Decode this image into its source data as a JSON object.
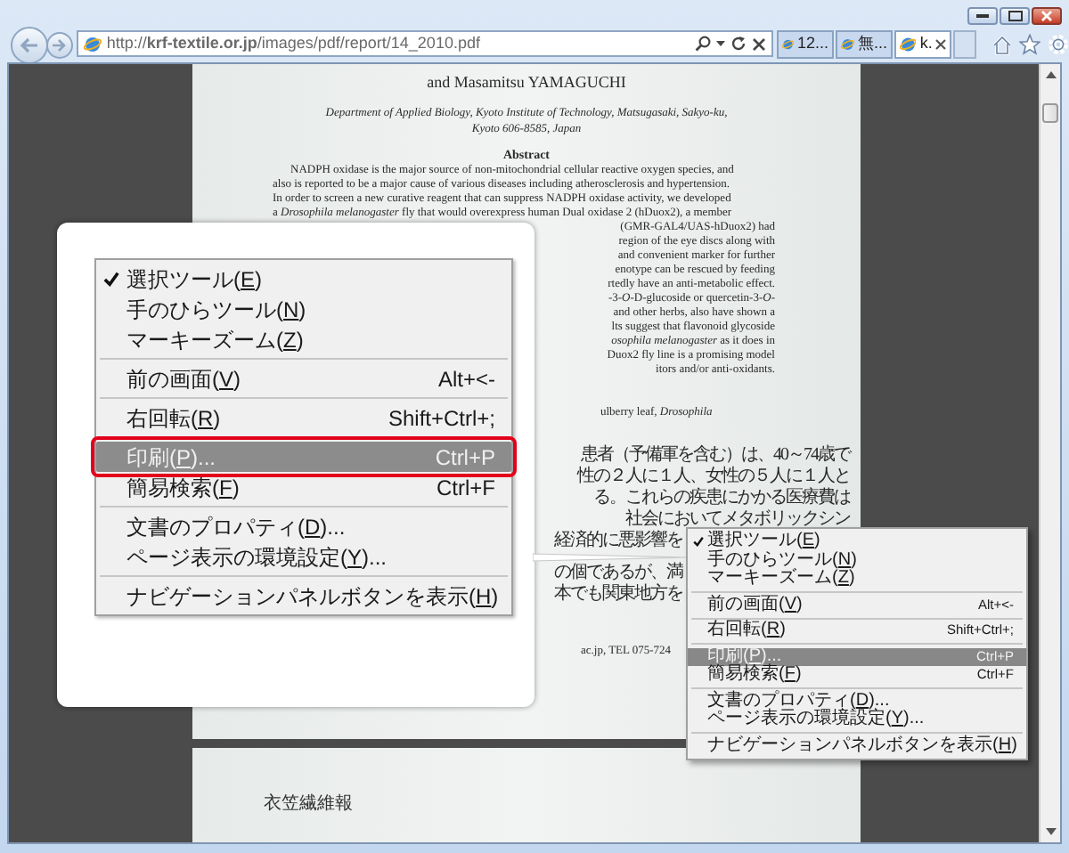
{
  "browser": {
    "address": "http://**krf-textile.or.jp**/images/pdf/report/14_2010.pdf",
    "tabs": [
      {
        "label": "12...",
        "selected": false
      },
      {
        "label": "無...",
        "selected": false
      },
      {
        "label": "k.",
        "selected": true
      }
    ]
  },
  "pdf": {
    "page_1": {
      "authors": "and Masamitsu YAMAGUCHI",
      "affiliation": [
        "Department of Applied Biology, Kyoto Institute of Technology, Matsugasaki, Sakyo-ku,",
        "Kyoto 606-8585, Japan"
      ],
      "abstract_heading": "Abstract",
      "abstract_lines": [
        "NADPH oxidase is the major source of non-mitochondrial cellular reactive oxygen species, and",
        "also is reported to be a major cause of various diseases including atherosclerosis and hypertension.",
        "In order to screen a new curative reagent that can suppress NADPH oxidase activity, we developed",
        "a *Drosophila melanogaster* fly that would overexpress human Dual oxidase 2 (hDuox2), a member"
      ],
      "abstract_fragments": [
        "(GMR-GAL4/UAS-hDuox2) had",
        "region of the eye discs along with",
        "and convenient marker for further",
        "enotype can be rescued by feeding",
        "rtedly have an anti-metabolic effect.",
        "-3-*O*-D-glucoside or quercetin-3-*O*-",
        "and other herbs, also have shown a",
        "lts suggest that flavonoid glycoside",
        "*osophila melanogaster* as it does in",
        "Duox2 fly line is a promising model",
        "itors and/or anti-oxidants."
      ],
      "keywords_fragment": "ulberry leaf, *Drosophila*",
      "japanese_fragments": [
        "患者（予備軍を含む）は、40～74歳で",
        "性の２人に１人、女性の５人に１人と",
        "る。これらの疾患にかかる医療費は",
        "社会においてメタボリックシン"
      ],
      "japanese_fragments_beside_menu": [
        "経済的に悪影響を",
        "の個であるが、満",
        "本でも関東地方を"
      ],
      "footnote_fragment": "ac.jp, TEL 075-724"
    },
    "page_2": {
      "header": "衣笠繊維報"
    }
  },
  "callout": {
    "menu": {
      "groups": [
        [
          {
            "before": "選択ツール(",
            "key": "E",
            "after": ")",
            "checked": true,
            "disabled": false,
            "selected": false,
            "outlined": false
          },
          {
            "before": "手のひらツール(",
            "key": "N",
            "after": ")",
            "checked": false,
            "disabled": false,
            "selected": false,
            "outlined": false
          },
          {
            "before": "マーキーズーム(",
            "key": "Z",
            "after": ")",
            "checked": false,
            "disabled": false,
            "selected": false,
            "outlined": false
          }
        ],
        [
          {
            "before": "前の画面(",
            "key": "V",
            "after": ")",
            "shortcut": "Alt+<-",
            "checked": false,
            "disabled": false,
            "selected": false,
            "outlined": false
          }
        ],
        [
          {
            "before": "右回転(",
            "key": "R",
            "after": ")",
            "shortcut": "Shift+Ctrl+;",
            "checked": false,
            "disabled": false,
            "selected": false,
            "outlined": false
          }
        ],
        [
          {
            "before": "印刷(",
            "key": "P",
            "after": ")...",
            "shortcut": "Ctrl+P",
            "checked": false,
            "disabled": true,
            "selected": true,
            "outlined": true
          },
          {
            "before": "簡易検索(",
            "key": "F",
            "after": ")",
            "shortcut": "Ctrl+F",
            "checked": false,
            "disabled": false,
            "selected": false,
            "outlined": false
          }
        ],
        [
          {
            "before": "文書のプロパティ(",
            "key": "D",
            "after": ")...",
            "checked": false,
            "disabled": false,
            "selected": false,
            "outlined": false
          },
          {
            "before": "ページ表示の環境設定(",
            "key": "Y",
            "after": ")...",
            "checked": false,
            "disabled": false,
            "selected": false,
            "outlined": false
          }
        ],
        [
          {
            "before": "ナビゲーションパネルボタンを表示(",
            "key": "H",
            "after": ")",
            "checked": false,
            "disabled": false,
            "selected": false,
            "outlined": false
          }
        ]
      ]
    }
  },
  "context_menu": {
    "groups": [
      [
        {
          "before": "選択ツール(",
          "key": "E",
          "after": ")",
          "checked": true,
          "disabled": false,
          "selected": false
        },
        {
          "before": "手のひらツール(",
          "key": "N",
          "after": ")",
          "checked": false,
          "disabled": false,
          "selected": false
        },
        {
          "before": "マーキーズーム(",
          "key": "Z",
          "after": ")",
          "checked": false,
          "disabled": false,
          "selected": false
        }
      ],
      [
        {
          "before": "前の画面(",
          "key": "V",
          "after": ")",
          "shortcut": "Alt+<-",
          "checked": false,
          "disabled": false,
          "selected": false
        }
      ],
      [
        {
          "before": "右回転(",
          "key": "R",
          "after": ")",
          "shortcut": "Shift+Ctrl+;",
          "checked": false,
          "disabled": false,
          "selected": false
        }
      ],
      [
        {
          "before": "印刷(",
          "key": "P",
          "after": ")...",
          "shortcut": "Ctrl+P",
          "checked": false,
          "disabled": true,
          "selected": true
        },
        {
          "before": "簡易検索(",
          "key": "F",
          "after": ")",
          "shortcut": "Ctrl+F",
          "checked": false,
          "disabled": false,
          "selected": false
        }
      ],
      [
        {
          "before": "文書のプロパティ(",
          "key": "D",
          "after": ")...",
          "checked": false,
          "disabled": false,
          "selected": false
        },
        {
          "before": "ページ表示の環境設定(",
          "key": "Y",
          "after": ")...",
          "checked": false,
          "disabled": false,
          "selected": false
        }
      ],
      [
        {
          "before": "ナビゲーションパネルボタンを表示(",
          "key": "H",
          "after": ")",
          "checked": false,
          "disabled": false,
          "selected": false
        }
      ]
    ]
  }
}
